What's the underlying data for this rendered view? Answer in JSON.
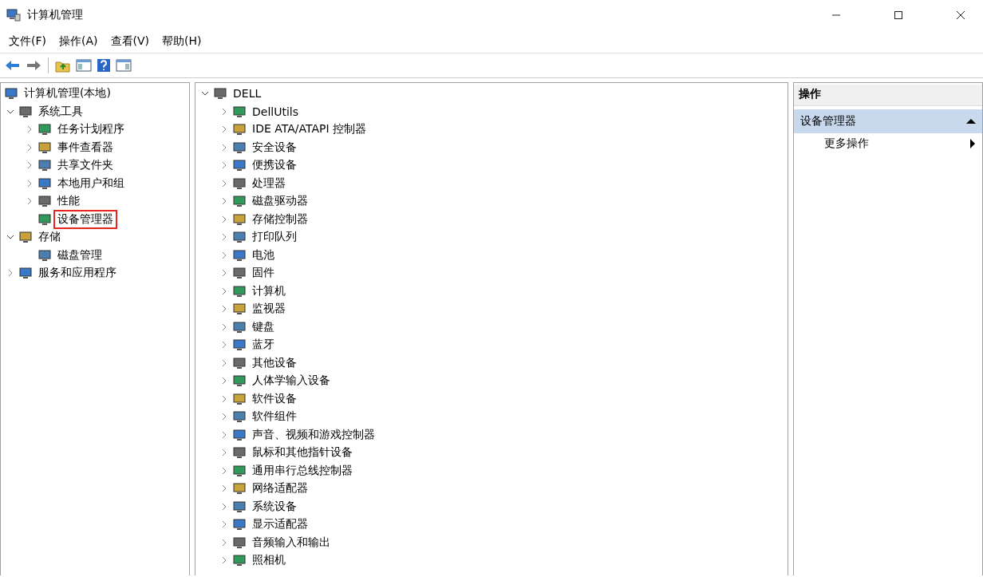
{
  "window": {
    "title": "计算机管理"
  },
  "menu": [
    "文件(F)",
    "操作(A)",
    "查看(V)",
    "帮助(H)"
  ],
  "left_tree": [
    {
      "label": "计算机管理(本地)",
      "children": [
        {
          "label": "系统工具",
          "expanded": true,
          "children": [
            {
              "label": "任务计划程序",
              "expanded": false
            },
            {
              "label": "事件查看器",
              "expanded": false
            },
            {
              "label": "共享文件夹",
              "expanded": false
            },
            {
              "label": "本地用户和组",
              "expanded": false
            },
            {
              "label": "性能",
              "expanded": false
            },
            {
              "label": "设备管理器",
              "highlighted": true
            }
          ]
        },
        {
          "label": "存储",
          "expanded": true,
          "children": [
            {
              "label": "磁盘管理"
            }
          ]
        },
        {
          "label": "服务和应用程序",
          "expanded": false
        }
      ]
    }
  ],
  "device_tree": [
    {
      "label": "DELL",
      "expanded": true,
      "children": [
        {
          "label": "DellUtils",
          "expanded": false
        },
        {
          "label": "IDE ATA/ATAPI 控制器",
          "expanded": false
        },
        {
          "label": "安全设备",
          "expanded": false
        },
        {
          "label": "便携设备",
          "expanded": false
        },
        {
          "label": "处理器",
          "expanded": false
        },
        {
          "label": "磁盘驱动器",
          "expanded": false
        },
        {
          "label": "存储控制器",
          "expanded": false
        },
        {
          "label": "打印队列",
          "expanded": false
        },
        {
          "label": "电池",
          "expanded": false
        },
        {
          "label": "固件",
          "expanded": false
        },
        {
          "label": "计算机",
          "expanded": false
        },
        {
          "label": "监视器",
          "expanded": false
        },
        {
          "label": "键盘",
          "expanded": false
        },
        {
          "label": "蓝牙",
          "expanded": false
        },
        {
          "label": "其他设备",
          "expanded": false
        },
        {
          "label": "人体学输入设备",
          "expanded": false
        },
        {
          "label": "软件设备",
          "expanded": false
        },
        {
          "label": "软件组件",
          "expanded": false
        },
        {
          "label": "声音、视频和游戏控制器",
          "expanded": false
        },
        {
          "label": "鼠标和其他指针设备",
          "expanded": false
        },
        {
          "label": "通用串行总线控制器",
          "expanded": false
        },
        {
          "label": "网络适配器",
          "expanded": false
        },
        {
          "label": "系统设备",
          "expanded": false
        },
        {
          "label": "显示适配器",
          "expanded": false
        },
        {
          "label": "音频输入和输出",
          "expanded": false
        },
        {
          "label": "照相机",
          "expanded": false
        }
      ]
    }
  ],
  "actions": {
    "title": "操作",
    "section": {
      "label": "设备管理器",
      "expanded": true
    },
    "items": [
      "更多操作"
    ]
  }
}
